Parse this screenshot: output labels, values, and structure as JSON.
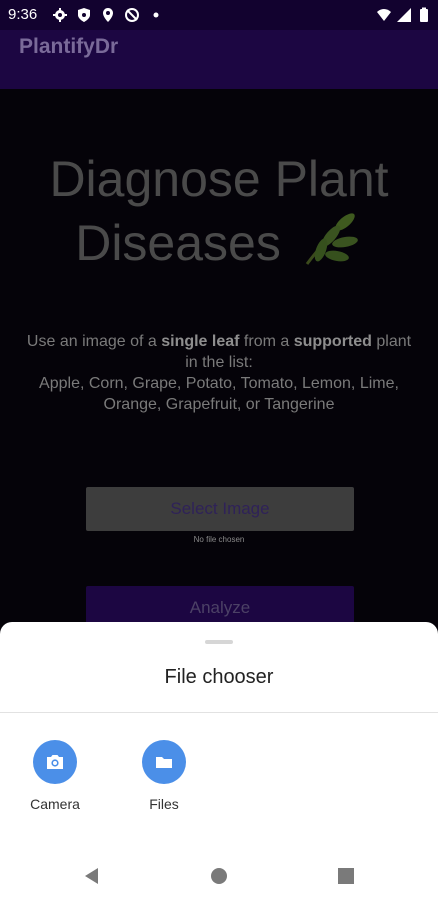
{
  "status_bar": {
    "time": "9:36",
    "icons_left": [
      "gear-icon",
      "shield-icon",
      "location-pin-icon",
      "no-data-icon",
      "dot-icon"
    ],
    "icons_right": [
      "wifi-icon",
      "signal-icon",
      "battery-icon"
    ]
  },
  "app_bar": {
    "title": "PlantifyDr"
  },
  "main": {
    "headline_line1": "Diagnose Plant",
    "headline_line2": "Diseases",
    "desc_prefix": "Use an image of a ",
    "desc_bold1": "single leaf",
    "desc_middle": " from a ",
    "desc_bold2": "supported",
    "desc_suffix": " plant in the list:",
    "supported_list": "Apple, Corn, Grape, Potato, Tomato, Lemon, Lime, Orange, Grapefruit, or Tangerine",
    "select_button": "Select Image",
    "no_file_text": "No file chosen",
    "analyze_button": "Analyze"
  },
  "sheet": {
    "title": "File chooser",
    "options": [
      {
        "label": "Camera",
        "icon": "camera-icon"
      },
      {
        "label": "Files",
        "icon": "folder-icon"
      }
    ]
  },
  "nav": {
    "buttons": [
      "back-icon",
      "home-icon",
      "recents-icon"
    ]
  },
  "colors": {
    "primary": "#1c0642",
    "status": "#12022f",
    "accent_blue": "#4b8fe8"
  }
}
